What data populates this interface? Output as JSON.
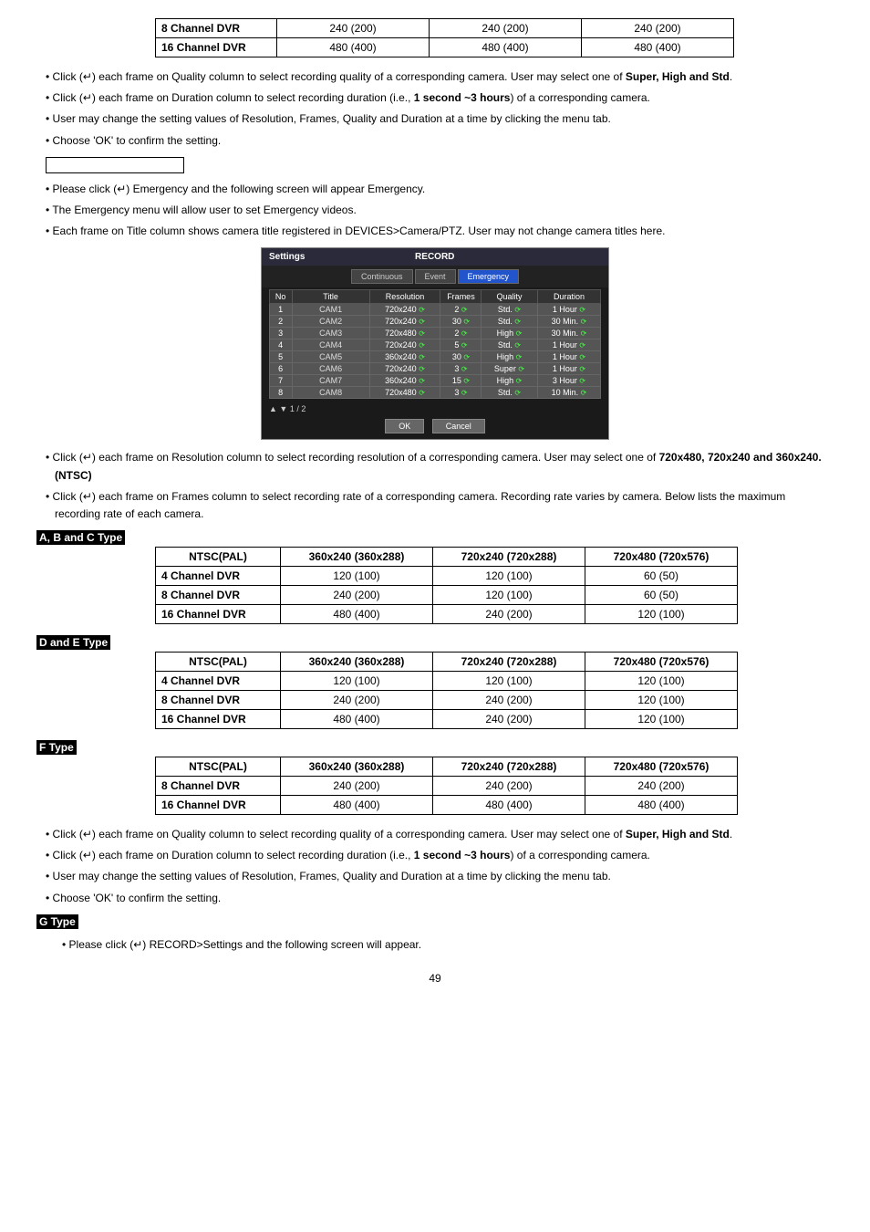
{
  "topTable": {
    "rows": [
      {
        "label": "8 Channel  DVR",
        "c1": "240 (200)",
        "c2": "240 (200)",
        "c3": "240 (200)"
      },
      {
        "label": "16 Channel DVR",
        "c1": "480 (400)",
        "c2": "480 (400)",
        "c3": "480 (400)"
      }
    ]
  },
  "bullets1": {
    "b1a": "• Click (↵) each frame on Quality column to select recording quality of a corresponding camera. User may select one of ",
    "b1b": "Super, High and Std",
    "b1c": ".",
    "b2a": "• Click (↵) each frame on Duration column to select recording duration (i.e., ",
    "b2b": "1 second ~3 hours",
    "b2c": ") of a corresponding camera.",
    "b3": "• User may change the setting values of Resolution, Frames, Quality and Duration at a time by clicking the menu tab.",
    "b4": "• Choose 'OK' to confirm the setting."
  },
  "bullets2": {
    "b1": "• Please click (↵) Emergency and the following screen will appear Emergency.",
    "b2": "• The Emergency menu will allow user to set Emergency videos.",
    "b3": "• Each frame on Title column shows camera title registered in DEVICES>Camera/PTZ. User may not change camera titles here."
  },
  "settings": {
    "title": "Settings",
    "record": "RECORD",
    "tabs": {
      "continuous": "Continuous",
      "event": "Event",
      "emergency": "Emergency"
    },
    "headers": {
      "no": "No",
      "title": "Title",
      "resolution": "Resolution",
      "frames": "Frames",
      "quality": "Quality",
      "duration": "Duration"
    },
    "rows": [
      {
        "no": "1",
        "title": "CAM1",
        "res": "720x240",
        "fr": "2",
        "q": "Std.",
        "dur": "1 Hour"
      },
      {
        "no": "2",
        "title": "CAM2",
        "res": "720x240",
        "fr": "30",
        "q": "Std.",
        "dur": "30 Min."
      },
      {
        "no": "3",
        "title": "CAM3",
        "res": "720x480",
        "fr": "2",
        "q": "High",
        "dur": "30 Min."
      },
      {
        "no": "4",
        "title": "CAM4",
        "res": "720x240",
        "fr": "5",
        "q": "Std.",
        "dur": "1 Hour"
      },
      {
        "no": "5",
        "title": "CAM5",
        "res": "360x240",
        "fr": "30",
        "q": "High",
        "dur": "1 Hour"
      },
      {
        "no": "6",
        "title": "CAM6",
        "res": "720x240",
        "fr": "3",
        "q": "Super",
        "dur": "1 Hour"
      },
      {
        "no": "7",
        "title": "CAM7",
        "res": "360x240",
        "fr": "15",
        "q": "High",
        "dur": "3 Hour"
      },
      {
        "no": "8",
        "title": "CAM8",
        "res": "720x480",
        "fr": "3",
        "q": "Std.",
        "dur": "10 Min."
      }
    ],
    "pager": "▲ ▼   1 / 2",
    "ok": "OK",
    "cancel": "Cancel"
  },
  "bullets3": {
    "b1a": "• Click (↵) each frame on Resolution column to select recording resolution of a corresponding camera. User may select one of ",
    "b1b": "720x480, 720x240 and 360x240. (NTSC)",
    "b2": "• Click (↵) each frame on Frames column to select recording rate of a corresponding camera. Recording rate varies by camera. Below lists the maximum recording rate of each camera."
  },
  "typeLabels": {
    "abc": "A, B and C Type",
    "de": "D and E Type",
    "f": "F Type",
    "g": "G Type"
  },
  "headersCommon": {
    "h1": "NTSC(PAL)",
    "h2": "360x240 (360x288)",
    "h3": "720x240 (720x288)",
    "h4": "720x480 (720x576)"
  },
  "tableABC": {
    "r1": {
      "label": "4 Channel  DVR",
      "c1": "120 (100)",
      "c2": "120 (100)",
      "c3": "60 (50)"
    },
    "r2": {
      "label": "8 Channel  DVR",
      "c1": "240 (200)",
      "c2": "120 (100)",
      "c3": "60 (50)"
    },
    "r3": {
      "label": "16 Channel DVR",
      "c1": "480 (400)",
      "c2": "240 (200)",
      "c3": "120 (100)"
    }
  },
  "tableDE": {
    "r1": {
      "label": "4 Channel  DVR",
      "c1": "120 (100)",
      "c2": "120 (100)",
      "c3": "120 (100)"
    },
    "r2": {
      "label": "8 Channel  DVR",
      "c1": "240 (200)",
      "c2": "240 (200)",
      "c3": "120 (100)"
    },
    "r3": {
      "label": "16 Channel DVR",
      "c1": "480 (400)",
      "c2": "240 (200)",
      "c3": "120 (100)"
    }
  },
  "tableF": {
    "r1": {
      "label": "8 Channel  DVR",
      "c1": "240 (200)",
      "c2": "240 (200)",
      "c3": "240 (200)"
    },
    "r2": {
      "label": "16 Channel DVR",
      "c1": "480 (400)",
      "c2": "480 (400)",
      "c3": "480 (400)"
    }
  },
  "bullets4": {
    "b1a": "• Click (↵) each frame on Quality column to select recording quality of a corresponding camera. User may select one of ",
    "b1b": "Super, High and Std",
    "b1c": ".",
    "b2a": "• Click (↵) each frame on Duration column to select recording duration (i.e., ",
    "b2b": "1 second ~3 hours",
    "b2c": ") of a corresponding camera.",
    "b3": "• User may change the setting values of Resolution, Frames, Quality and Duration at a time by clicking the menu tab.",
    "b4": "• Choose 'OK' to confirm the setting."
  },
  "lastBullet": "• Please click (↵) RECORD>Settings and the following screen will appear.",
  "pageNum": "49"
}
